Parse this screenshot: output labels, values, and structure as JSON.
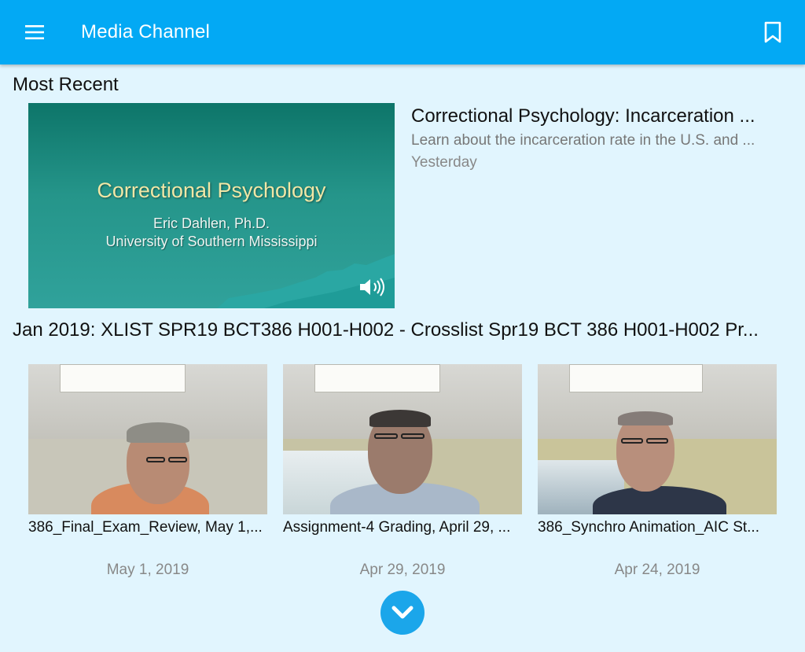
{
  "appbar": {
    "title": "Media Channel",
    "menu_icon": "hamburger-menu-icon",
    "bookmark_icon": "bookmark-icon",
    "color": "#03a9f4"
  },
  "most_recent": {
    "heading": "Most Recent",
    "item": {
      "slide_title": "Correctional Psychology",
      "slide_author": "Eric Dahlen, Ph.D.",
      "slide_university": "University of Southern Mississippi",
      "title": "Correctional Psychology: Incarceration ...",
      "description": "Learn about the incarceration rate in the U.S. and ...",
      "date": "Yesterday"
    }
  },
  "playlist": {
    "heading": "Jan 2019: XLIST SPR19 BCT386 H001-H002 - Crosslist Spr19 BCT 386 H001-H002 Pr...",
    "items": [
      {
        "title": "386_Final_Exam_Review, May 1,...",
        "date": "May 1, 2019"
      },
      {
        "title": "Assignment-4 Grading, April 29, ...",
        "date": "Apr 29, 2019"
      },
      {
        "title": "386_Synchro Animation_AIC St...",
        "date": "Apr 24, 2019"
      }
    ]
  },
  "expand_icon": "chevron-down-icon",
  "background_color": "#e1f5fe"
}
